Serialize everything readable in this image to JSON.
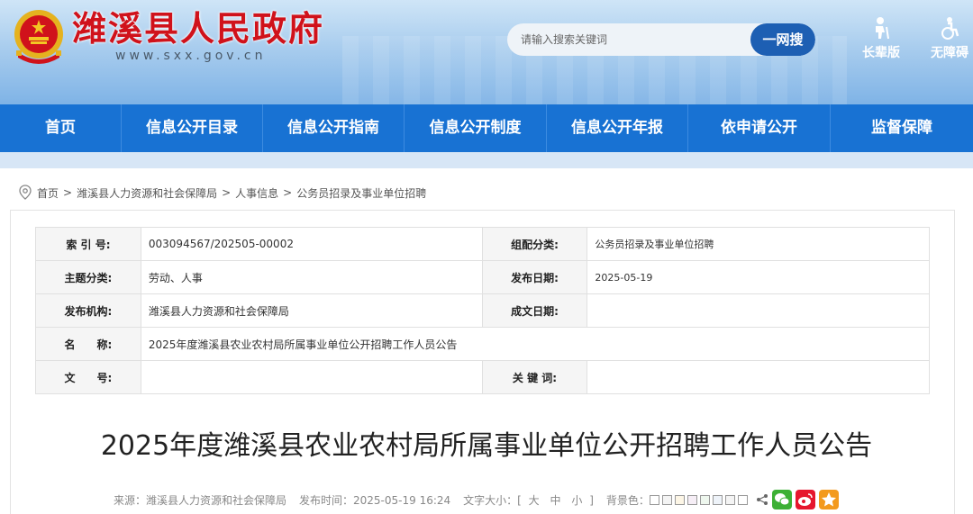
{
  "header": {
    "site_title": "潍溪县人民政府",
    "site_domain": "www.sxx.gov.cn",
    "search_placeholder": "请输入搜索关键词",
    "search_button": "一网搜",
    "elder_mode": "长辈版",
    "accessibility": "无障碍"
  },
  "nav": {
    "items": [
      "首页",
      "信息公开目录",
      "信息公开指南",
      "信息公开制度",
      "信息公开年报",
      "依申请公开",
      "监督保障"
    ]
  },
  "breadcrumb": [
    "首页",
    "潍溪县人力资源和社会保障局",
    "人事信息",
    "公务员招录及事业单位招聘"
  ],
  "meta": {
    "index_label": "索 引 号:",
    "index_value": "003094567/202505-00002",
    "category_label": "组配分类:",
    "category_value": "公务员招录及事业单位招聘",
    "topic_label": "主题分类:",
    "topic_value": "劳动、人事",
    "pub_date_label": "发布日期:",
    "pub_date_value": "2025-05-19",
    "agency_label": "发布机构:",
    "agency_value": "潍溪县人力资源和社会保障局",
    "doc_date_label": "成文日期:",
    "doc_date_value": "",
    "name_label": "名　　称:",
    "name_value": "2025年度潍溪县农业农村局所属事业单位公开招聘工作人员公告",
    "doc_no_label": "文　　号:",
    "doc_no_value": "",
    "keywords_label": "关 键 词:",
    "keywords_value": ""
  },
  "article": {
    "title": "2025年度潍溪县农业农村局所属事业单位公开招聘工作人员公告",
    "source": "来源：潍溪县人力资源和社会保障局",
    "publish_time": "发布时间：2025-05-19 16:24",
    "font_size_label": "文字大小：[",
    "font_size_options": [
      "大",
      "中",
      "小"
    ],
    "font_size_close": "]",
    "bg_color_label": "背景色：",
    "bg_colors": [
      "#ffffff",
      "#f4f4f4",
      "#fdf6e6",
      "#f6eef6",
      "#eef7ee",
      "#eef3f9",
      "#f4f4f4",
      "#ffffff"
    ]
  },
  "colors": {
    "nav_blue": "#1872d3",
    "title_red": "#d0121b",
    "wechat": "#3cb034",
    "weibo": "#e6162d",
    "favorite": "#f39a1d"
  }
}
